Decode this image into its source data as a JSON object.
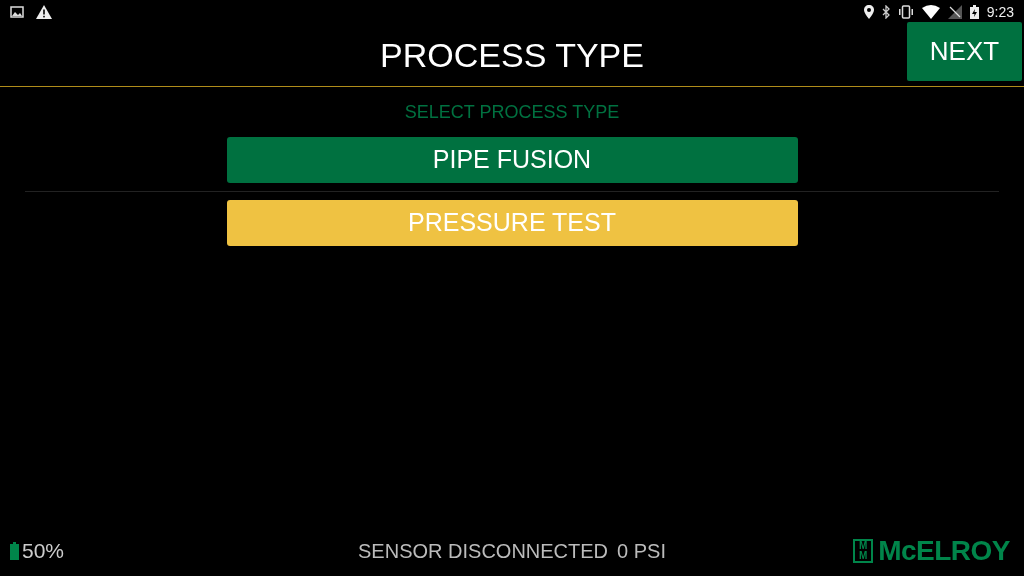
{
  "status_bar": {
    "time": "9:23"
  },
  "header": {
    "title": "PROCESS TYPE",
    "next_button": "NEXT"
  },
  "prompt": "SELECT PROCESS TYPE",
  "options": [
    {
      "label": "PIPE FUSION",
      "color": "#007140"
    },
    {
      "label": "PRESSURE TEST",
      "color": "#efc242"
    }
  ],
  "footer": {
    "battery": "50%",
    "sensor_status": "SENSOR DISCONNECTED",
    "pressure": "0 PSI",
    "logo": {
      "mark": [
        "M",
        "M"
      ],
      "name": "McELROY"
    }
  }
}
